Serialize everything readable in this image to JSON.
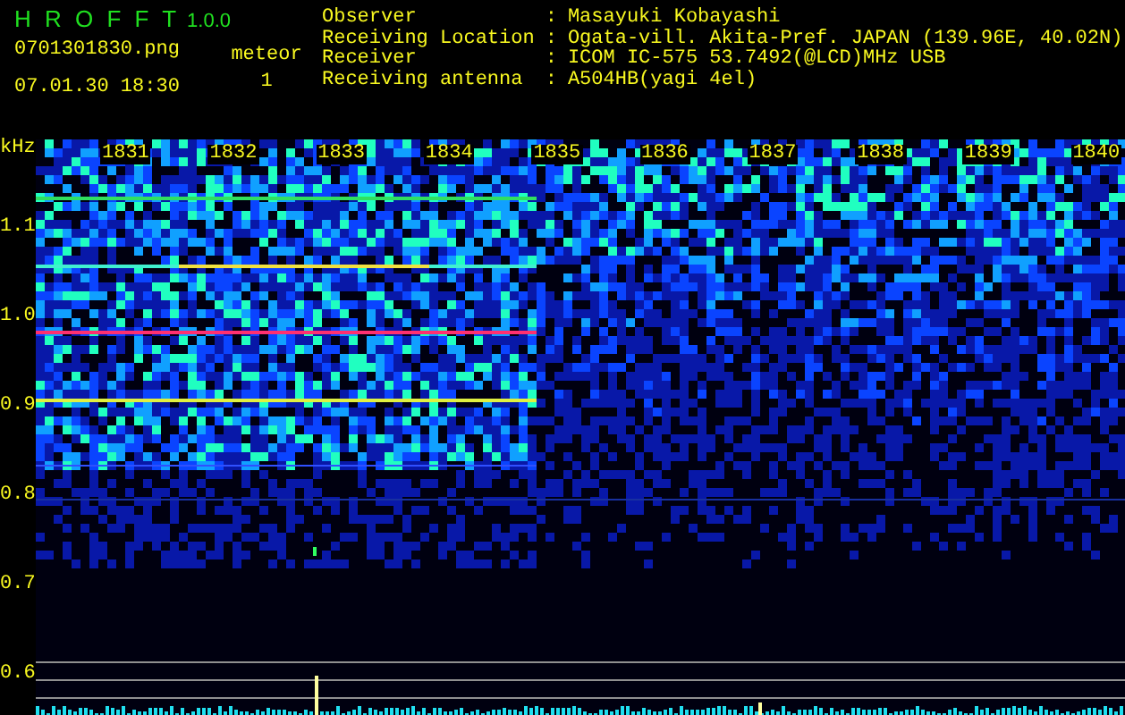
{
  "app": {
    "title": "H R O F F T",
    "version": "1.0.0"
  },
  "file": {
    "name": "0701301830.png",
    "datetime": "07.01.30 18:30"
  },
  "meteor": {
    "label": "meteor",
    "count": "1"
  },
  "info": [
    {
      "label": "Observer",
      "separator": ":",
      "value": "Masayuki Kobayashi"
    },
    {
      "label": "Receiving Location",
      "separator": ":",
      "value": "Ogata-vill. Akita-Pref. JAPAN (139.96E, 40.02N)"
    },
    {
      "label": "Receiver",
      "separator": ":",
      "value": "ICOM IC-575 53.7492(@LCD)MHz USB"
    },
    {
      "label": "Receiving antenna",
      "separator": ":",
      "value": "A504HB(yagi 4el)"
    }
  ],
  "spectrogram": {
    "unit": "kHz",
    "time_labels": [
      "1831",
      "1832",
      "1833",
      "1834",
      "1835",
      "1836",
      "1837",
      "1838",
      "1839",
      "1840"
    ],
    "freq_labels": [
      "1.1",
      "1.0",
      "0.9",
      "0.8",
      "0.7",
      "0.6"
    ]
  }
}
